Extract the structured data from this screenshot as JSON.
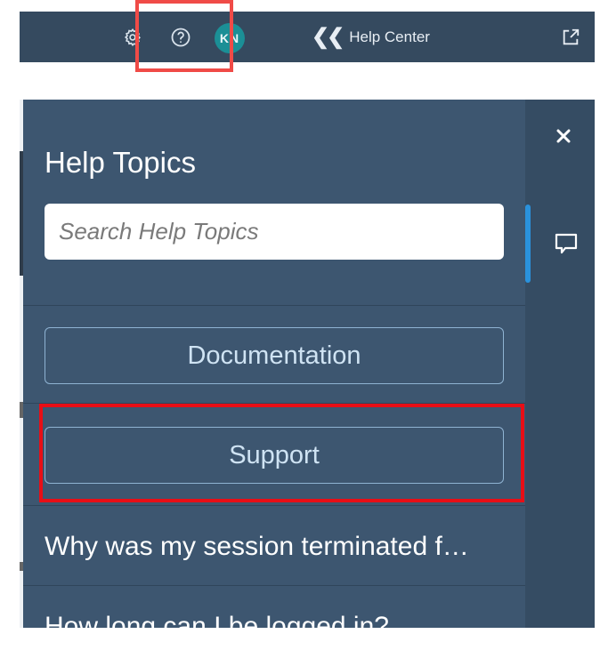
{
  "topbar": {
    "avatar_initials": "KN",
    "help_center_label": "Help Center",
    "icons": [
      "gear-icon",
      "help-icon",
      "popout-icon",
      "chevrons-left-icon"
    ]
  },
  "help_panel": {
    "title": "Help Topics",
    "search": {
      "placeholder": "Search Help Topics",
      "value": ""
    },
    "buttons": {
      "documentation": "Documentation",
      "support": "Support"
    },
    "topics": [
      "Why was my session terminated f…",
      "How long can I be logged in?"
    ]
  },
  "rail": {
    "icons": [
      "close-icon",
      "chat-icon"
    ]
  },
  "colors": {
    "shell_bar": "#354a5f",
    "panel": "#3d5670",
    "rail": "#354c63",
    "accent": "#2a92dc",
    "highlight": "#e80e16",
    "avatar": "#1b8f96"
  }
}
